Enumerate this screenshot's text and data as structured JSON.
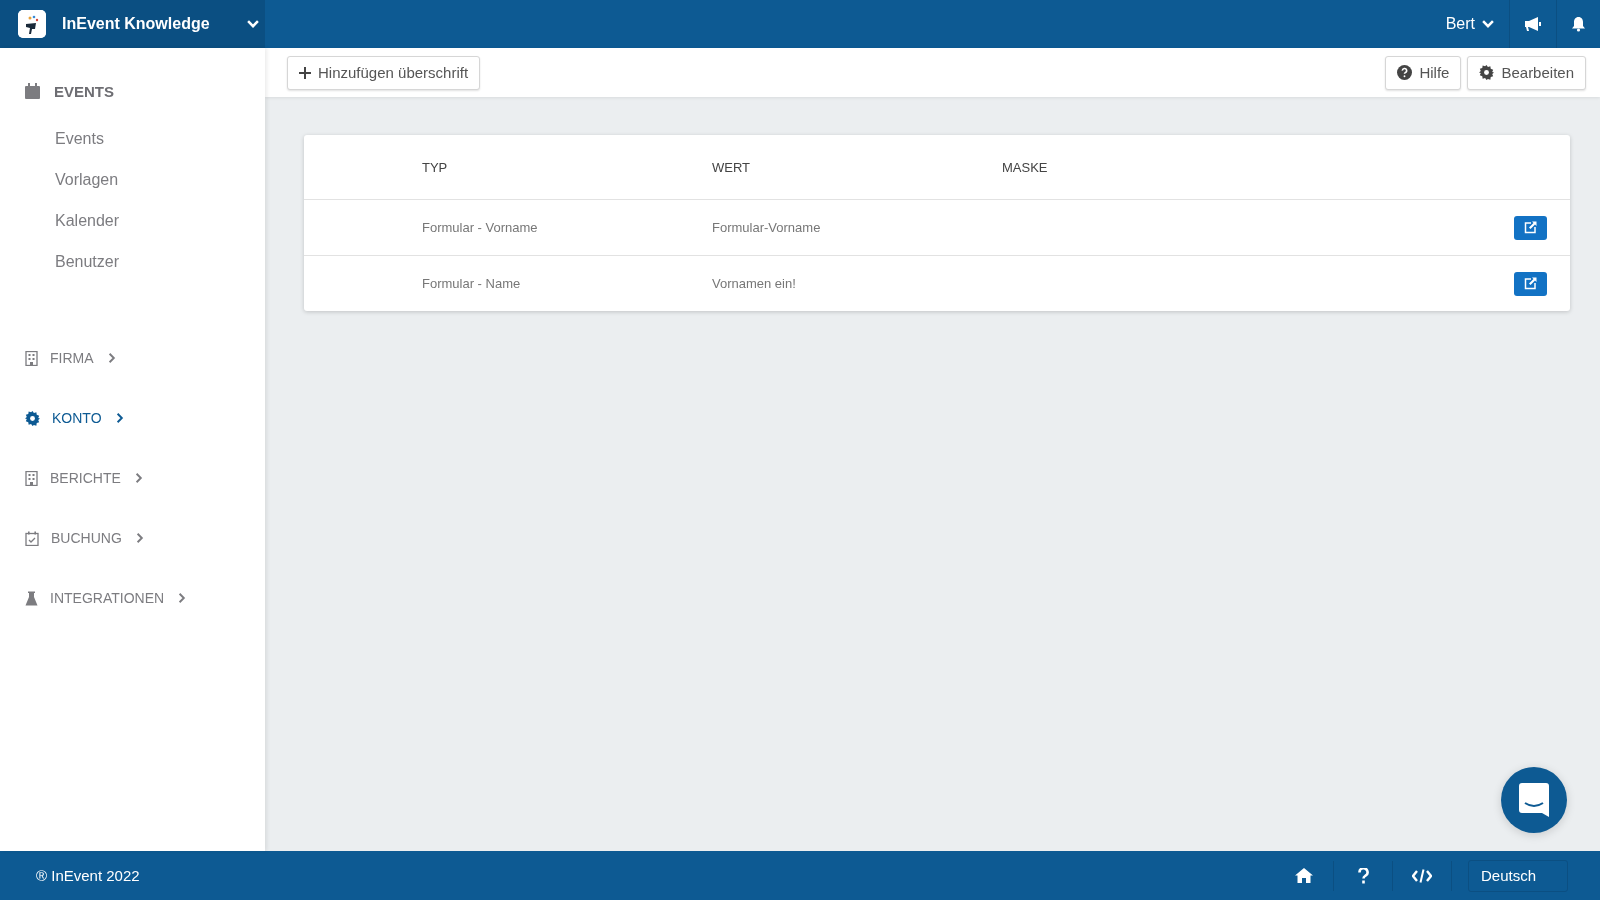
{
  "topbar": {
    "workspace": "InEvent Knowledge",
    "user": "Bert"
  },
  "sidebar": {
    "header": {
      "label": "EVENTS"
    },
    "items": [
      {
        "label": "Events"
      },
      {
        "label": "Vorlagen"
      },
      {
        "label": "Kalender"
      },
      {
        "label": "Benutzer"
      }
    ],
    "sections": [
      {
        "label": "FIRMA",
        "selected": false
      },
      {
        "label": "KONTO",
        "selected": true
      },
      {
        "label": "BERICHTE",
        "selected": false
      },
      {
        "label": "BUCHUNG",
        "selected": false
      },
      {
        "label": "INTEGRATIONEN",
        "selected": false
      }
    ]
  },
  "toolbar": {
    "add_button": "Hinzufügen überschrift",
    "help_button": "Hilfe",
    "edit_button": "Bearbeiten"
  },
  "table": {
    "columns": [
      "TYP",
      "WERT",
      "MASKE"
    ],
    "rows": [
      {
        "typ": "Formular - Vorname",
        "wert": "Formular-Vorname"
      },
      {
        "typ": "Formular - Name",
        "wert": "Vornamen ein!"
      }
    ]
  },
  "footer": {
    "copyright": "® InEvent 2022",
    "language": "Deutsch"
  }
}
